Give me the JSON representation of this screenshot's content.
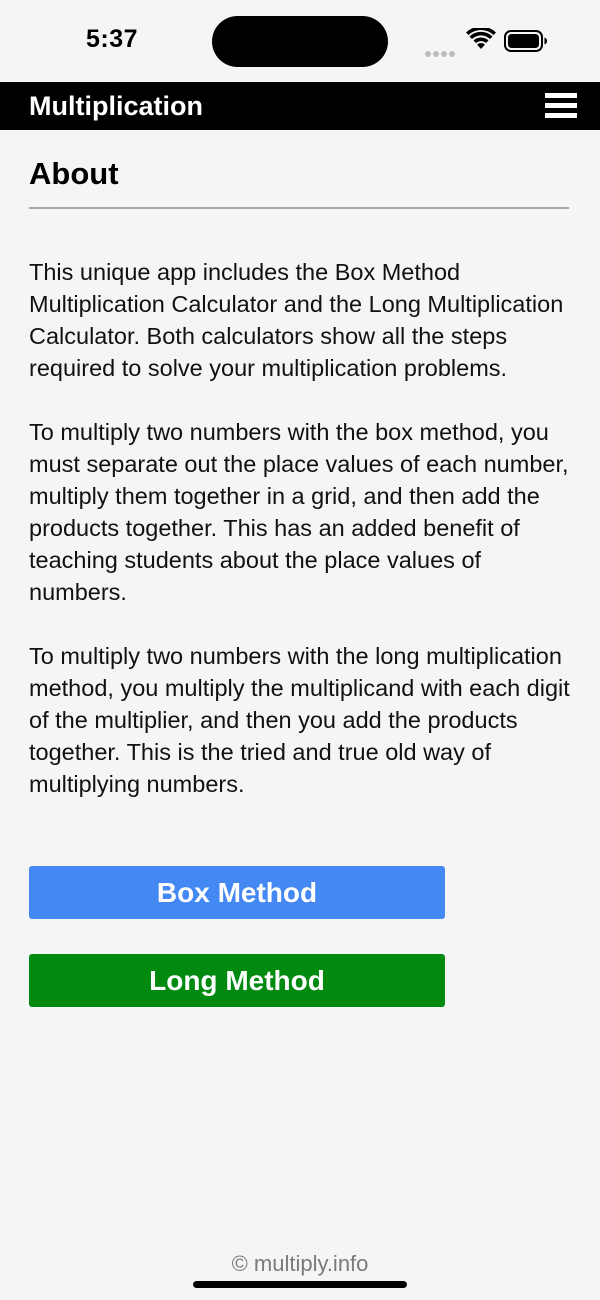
{
  "status_bar": {
    "time": "5:37",
    "icons": [
      "signal-icon",
      "wifi-icon",
      "battery-icon"
    ]
  },
  "navbar": {
    "title": "Multiplication",
    "menu_icon": "menu-icon"
  },
  "page": {
    "title": "About",
    "paragraphs": [
      "This unique app includes the Box Method Multiplication Calculator and the Long Multiplication Calculator. Both calculators show all the steps required to solve your multiplication problems.",
      "To multiply two numbers with the box method, you must separate out the place values of each number, multiply them together in a grid, and then add the products together. This has an added benefit of teaching students about the place values of numbers.",
      "To multiply two numbers with the long multiplication method, you multiply the multiplicand with each digit of the multiplier, and then you add the products together. This is the tried and true old way of multiplying numbers."
    ]
  },
  "buttons": {
    "box_method": "Box Method",
    "long_method": "Long Method"
  },
  "footer": {
    "copyright": "© multiply.info"
  },
  "colors": {
    "navbar_bg": "#000000",
    "box_button": "#4488f4",
    "long_button": "#008a0f",
    "background": "#f5f5f5"
  }
}
